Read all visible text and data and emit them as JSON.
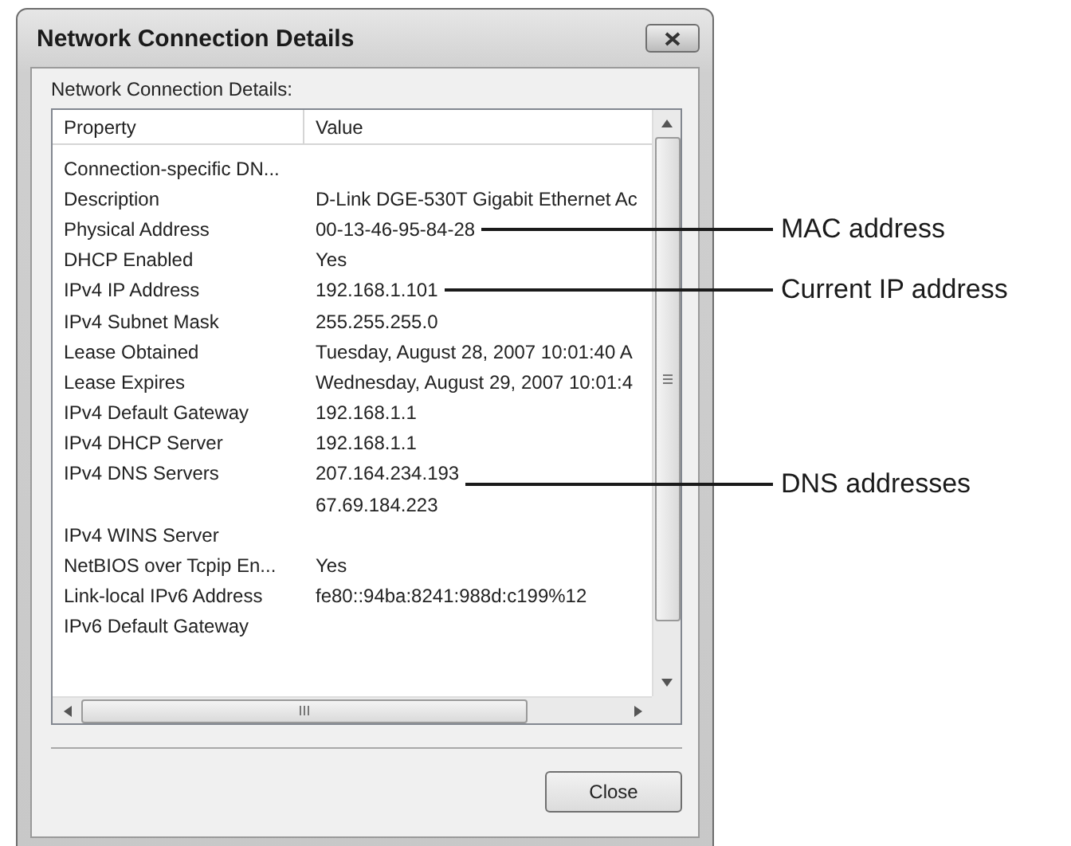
{
  "window": {
    "title": "Network Connection Details"
  },
  "list_label": "Network Connection Details:",
  "table": {
    "columns": [
      "Property",
      "Value"
    ],
    "rows": [
      {
        "property": "Connection-specific DN..."
      },
      {
        "property": "Description",
        "value": "D-Link DGE-530T Gigabit Ethernet Ac"
      },
      {
        "property": "Physical Address",
        "value": "00-13-46-95-84-28",
        "callout": "MAC address"
      },
      {
        "property": "DHCP Enabled",
        "value": "Yes"
      },
      {
        "property": "IPv4 IP Address",
        "value": "192.168.1.101",
        "callout": "Current IP address"
      },
      {
        "property": "IPv4 Subnet Mask",
        "value": "255.255.255.0"
      },
      {
        "property": "Lease Obtained",
        "value": "Tuesday, August 28, 2007 10:01:40 A"
      },
      {
        "property": "Lease Expires",
        "value": "Wednesday, August 29, 2007 10:01:4"
      },
      {
        "property": "IPv4 Default Gateway",
        "value": "192.168.1.1"
      },
      {
        "property": "IPv4 DHCP Server",
        "value": "192.168.1.1"
      },
      {
        "property": "IPv4 DNS Servers",
        "value": "207.164.234.193",
        "callout": "DNS addresses"
      },
      {
        "value": "67.69.184.223"
      },
      {
        "property": "IPv4 WINS Server"
      },
      {
        "property": "NetBIOS over Tcpip En...",
        "value": "Yes"
      },
      {
        "property": "Link-local IPv6 Address",
        "value": "fe80::94ba:8241:988d:c199%12"
      },
      {
        "property": "IPv6 Default Gateway"
      }
    ]
  },
  "buttons": [
    "Close"
  ]
}
